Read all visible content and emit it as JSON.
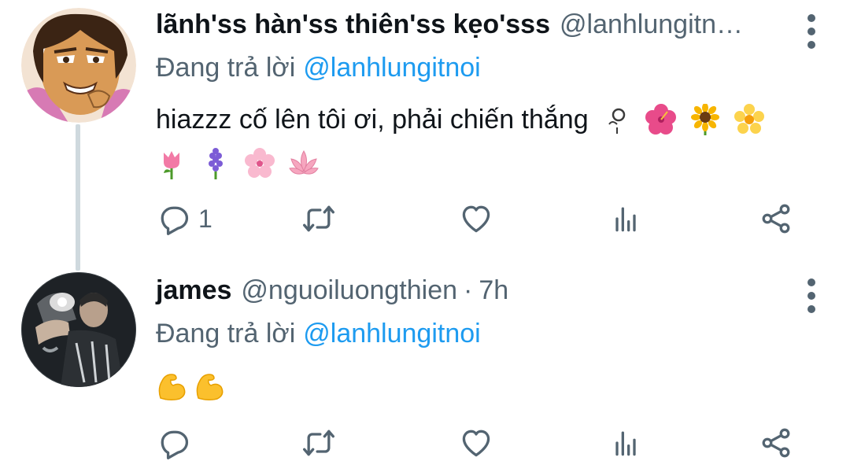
{
  "tweets": [
    {
      "name": "lãnh'ss hàn'ss thiên'ss kẹo'sss",
      "handle": "@lanhlungitn…",
      "replying_prefix": "Đang trả lời",
      "replying_to": "@lanhlungitnoi",
      "text": "hiazzz cố lên tôi ơi, phải chiến thắng",
      "emojis_line1": [
        "rosette",
        "hibiscus",
        "sunflower",
        "blossom"
      ],
      "emojis_line2": [
        "tulip",
        "hyacinth",
        "cherry-blossom",
        "lotus"
      ],
      "reply_count": "1"
    },
    {
      "name": "james",
      "handle": "@nguoiluongthien",
      "separator": "·",
      "time": "7h",
      "replying_prefix": "Đang trả lời",
      "replying_to": "@lanhlungitnoi",
      "emojis": [
        "flexed-biceps",
        "flexed-biceps"
      ]
    }
  ],
  "colors": {
    "text": "#0f1419",
    "muted": "#536471",
    "link": "#1d9bf0",
    "thread_line": "#cfd9de"
  }
}
